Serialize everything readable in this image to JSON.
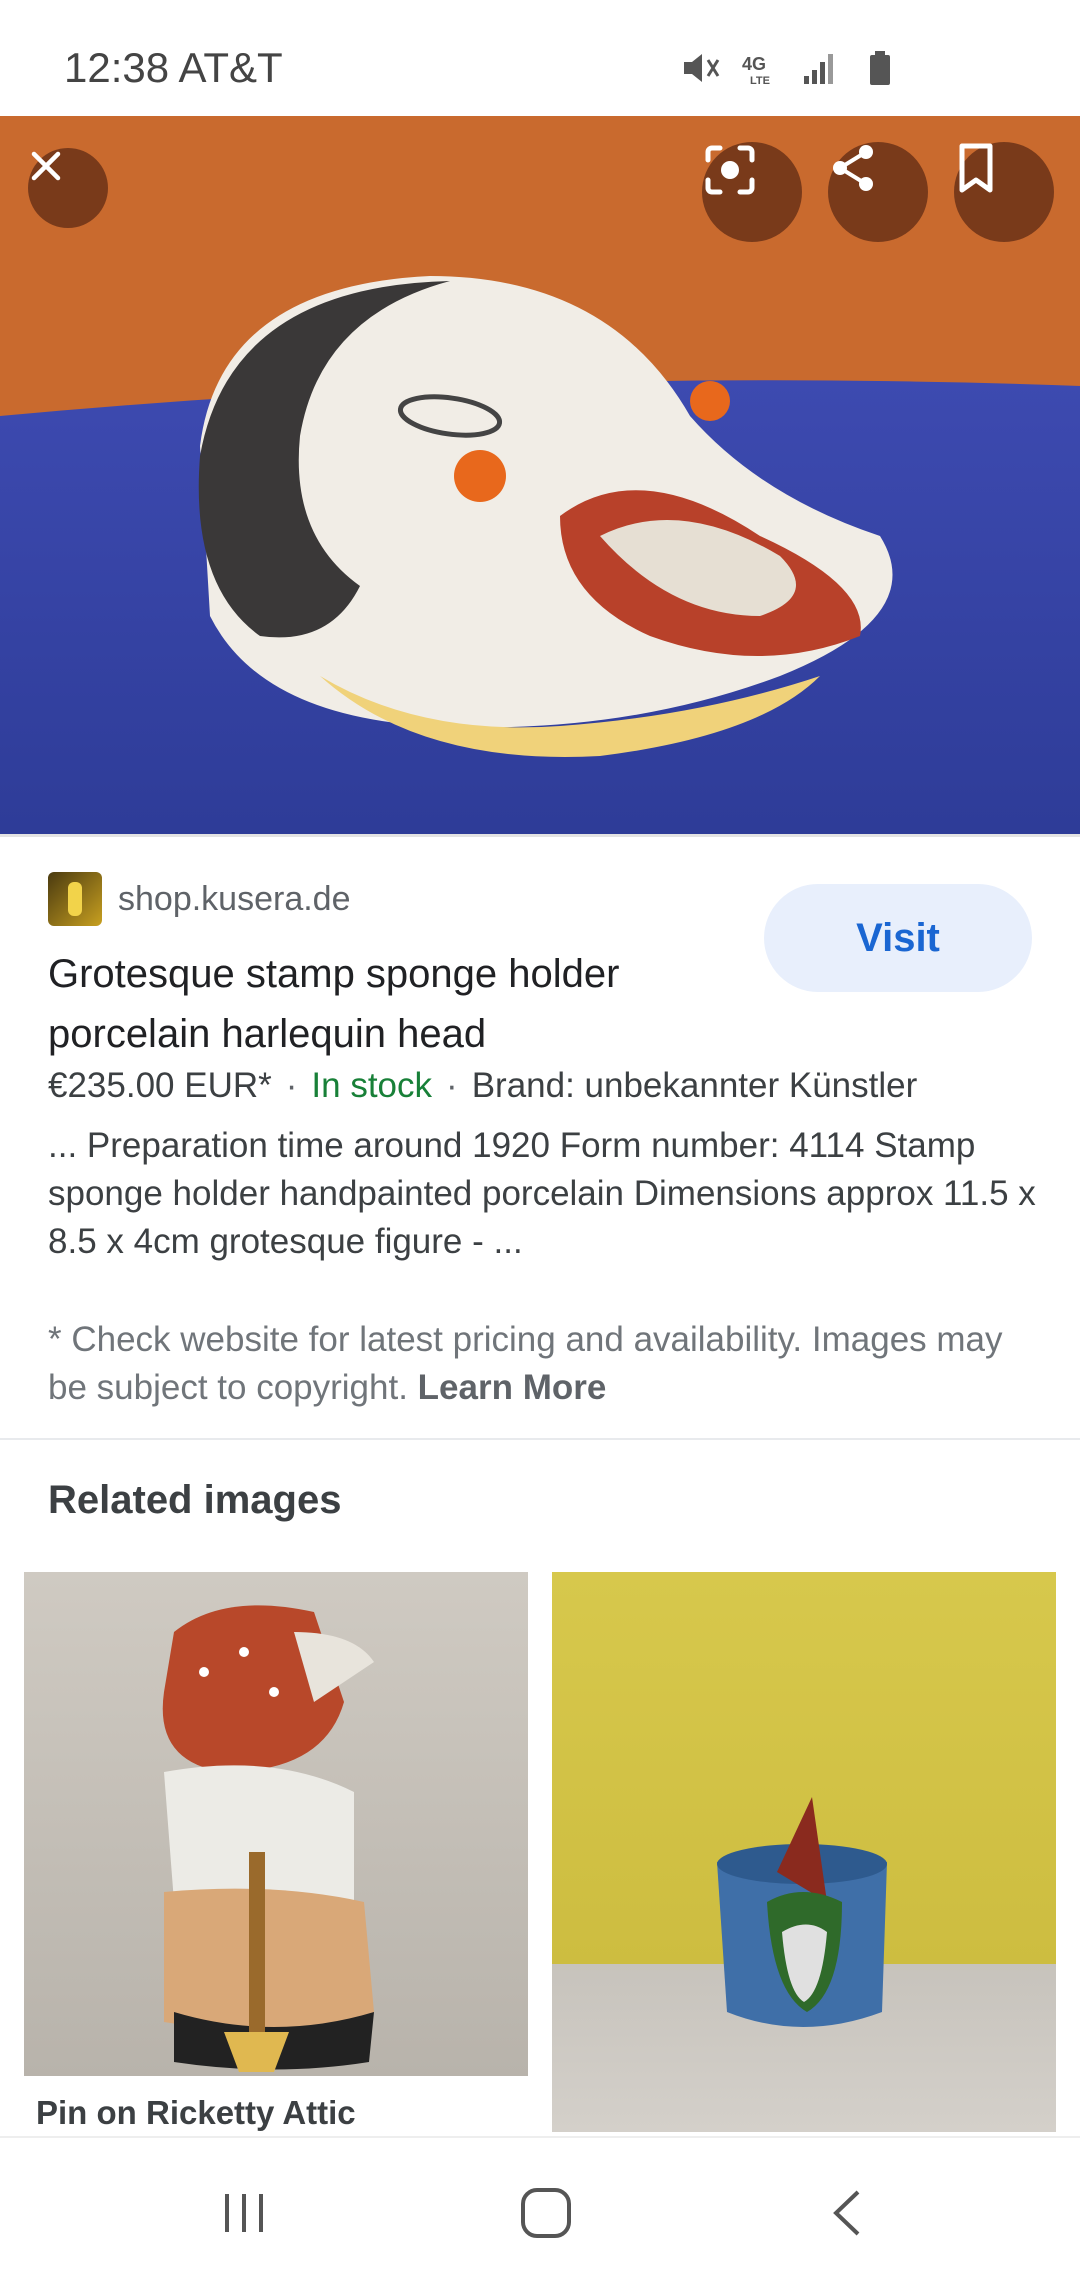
{
  "status_bar": {
    "time": "12:38 AT&T",
    "network": "4G",
    "network_sub": "LTE"
  },
  "hero": {
    "close_icon": "close-icon",
    "lens_icon": "lens-icon",
    "share_icon": "share-icon",
    "bookmark_icon": "bookmark-icon"
  },
  "result": {
    "source": "shop.kusera.de",
    "visit_label": "Visit",
    "title": "Grotesque stamp sponge holder porcelain harlequin head",
    "price": "€235.00 EUR*",
    "stock": "In stock",
    "brand": "Brand: unbekannter Künstler",
    "description": "... Preparation time around 1920 Form number: 4114 Stamp sponge holder handpainted porcelain Dimensions approx 11.5 x 8.5 x 4cm grotesque figure - ...",
    "disclaimer": "* Check website for latest pricing and availability. Images may be subject to copyright.",
    "learn_more": "Learn More"
  },
  "related": {
    "heading": "Related images",
    "items": [
      {
        "caption": "Pin on Ricketty Attic"
      },
      {
        "caption": ""
      }
    ]
  },
  "colors": {
    "accent": "#1a66d2",
    "stock": "#188038",
    "visit_bg": "#e8effc"
  }
}
